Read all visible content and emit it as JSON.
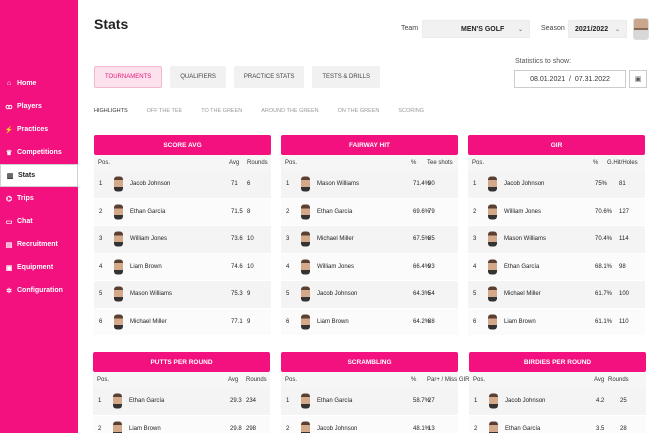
{
  "colors": {
    "accent": "#f2117e",
    "accent_light": "#fde2ee"
  },
  "sidebar": {
    "items": [
      {
        "label": "Home",
        "icon": "home-icon",
        "glyph": "⌂"
      },
      {
        "label": "Players",
        "icon": "players-icon",
        "glyph": "ꝏ"
      },
      {
        "label": "Practices",
        "icon": "practices-icon",
        "glyph": "⚡"
      },
      {
        "label": "Competitions",
        "icon": "trophy-icon",
        "glyph": "♛"
      },
      {
        "label": "Stats",
        "icon": "stats-icon",
        "glyph": "▥",
        "active": true
      },
      {
        "label": "Trips",
        "icon": "trips-icon",
        "glyph": "⌬"
      },
      {
        "label": "Chat",
        "icon": "chat-icon",
        "glyph": "▭"
      },
      {
        "label": "Recruitment",
        "icon": "recruitment-icon",
        "glyph": "▤"
      },
      {
        "label": "Equipment",
        "icon": "equipment-icon",
        "glyph": "▣"
      },
      {
        "label": "Configuration",
        "icon": "gear-icon",
        "glyph": "✲"
      }
    ]
  },
  "header": {
    "title": "Stats",
    "team_label": "Team",
    "team_value": "MEN'S GOLF",
    "season_label": "Season",
    "season_value": "2021/2022"
  },
  "tabs": [
    "TOURNAMENTS",
    "QUALIFIERS",
    "PRACTICE STATS",
    "TESTS & DRILLS"
  ],
  "statistics": {
    "label": "Statistics to show:",
    "date_range": "08.01.2021  /  07.31.2022"
  },
  "subtabs": [
    "HIGHLIGHTS",
    "OFF THE TEE",
    "TO THE GREEN",
    "AROUND THE GREEN",
    "ON THE GREEN",
    "SCORING"
  ],
  "cards": [
    {
      "title": "SCORE AVG",
      "columns": [
        "Pos.",
        "Avg",
        "Rounds"
      ],
      "rows": [
        [
          "1",
          "Jacob Johnson",
          "71",
          "6"
        ],
        [
          "2",
          "Ethan García",
          "71.5",
          "8"
        ],
        [
          "3",
          "William Jones",
          "73.6",
          "10"
        ],
        [
          "4",
          "Liam Brown",
          "74.6",
          "10"
        ],
        [
          "5",
          "Mason Williams",
          "75.3",
          "9"
        ],
        [
          "6",
          "Michael Miller",
          "77.1",
          "9"
        ]
      ]
    },
    {
      "title": "FAIRWAY HIT",
      "columns": [
        "Pos.",
        "%",
        "Tee shots"
      ],
      "rows": [
        [
          "1",
          "Mason Williams",
          "71.4%",
          "90"
        ],
        [
          "2",
          "Ethan García",
          "69.6%",
          "79"
        ],
        [
          "3",
          "Michael Miller",
          "67.5%",
          "85"
        ],
        [
          "4",
          "William Jones",
          "66.4%",
          "93"
        ],
        [
          "5",
          "Jacob Johnson",
          "64.3%",
          "54"
        ],
        [
          "6",
          "Liam Brown",
          "64.2%",
          "88"
        ]
      ]
    },
    {
      "title": "GIR",
      "columns": [
        "Pos.",
        "%",
        "G.Hit/Holes"
      ],
      "rows": [
        [
          "1",
          "Jacob Johnson",
          "75%",
          "81"
        ],
        [
          "2",
          "William Jones",
          "70.6%",
          "127"
        ],
        [
          "3",
          "Mason Williams",
          "70.4%",
          "114"
        ],
        [
          "4",
          "Ethan García",
          "68.1%",
          "98"
        ],
        [
          "5",
          "Michael Miller",
          "61.7%",
          "100"
        ],
        [
          "6",
          "Liam Brown",
          "61.1%",
          "110"
        ]
      ]
    },
    {
      "title": "PUTTS PER ROUND",
      "columns": [
        "Pos.",
        "Avg",
        "Rounds"
      ],
      "rows": [
        [
          "1",
          "Ethan García",
          "29.3",
          "234"
        ],
        [
          "2",
          "Liam Brown",
          "29.8",
          "298"
        ]
      ]
    },
    {
      "title": "SCRAMBLING",
      "columns": [
        "Pos.",
        "%",
        "Par+ / Miss GIR"
      ],
      "rows": [
        [
          "1",
          "Ethan García",
          "58.7%",
          "27"
        ],
        [
          "2",
          "Jacob Johnson",
          "48.1%",
          "13"
        ]
      ]
    },
    {
      "title": "BIRDIES PER ROUND",
      "columns": [
        "Pos.",
        "Avg",
        "Rounds"
      ],
      "rows": [
        [
          "1",
          "Jacob Johnson",
          "4.2",
          "25"
        ],
        [
          "2",
          "Ethan García",
          "3.5",
          "28"
        ]
      ]
    }
  ]
}
